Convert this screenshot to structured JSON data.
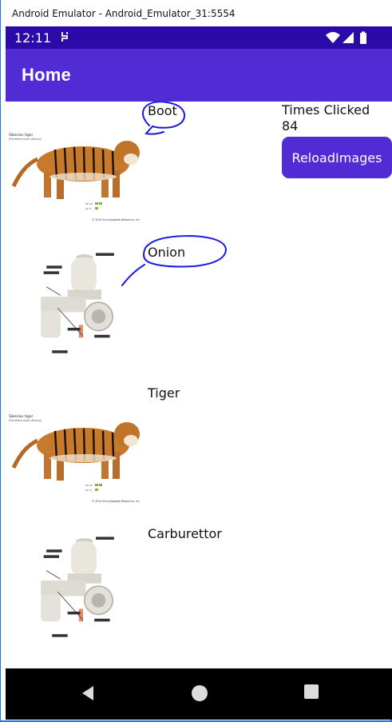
{
  "window": {
    "title": "Android Emulator - Android_Emulator_31:5554"
  },
  "status_bar": {
    "time": "12:11",
    "icons": [
      "sync-icon",
      "wifi-icon",
      "signal-icon",
      "battery-icon"
    ]
  },
  "app_bar": {
    "title": "Home"
  },
  "panel": {
    "times_clicked_label": "Times Clicked",
    "times_clicked_value": "84",
    "reload_button_label": "ReloadImages"
  },
  "rows": [
    {
      "label": "Boot",
      "image": "tiger"
    },
    {
      "label": "Onion",
      "image": "carburettor"
    },
    {
      "label": "Tiger",
      "image": "tiger"
    },
    {
      "label": "Carburettor",
      "image": "carburettor"
    }
  ],
  "figure_text": {
    "tiger_title": "Siberian tiger",
    "tiger_subtitle": "(Panthera tigris altaica)",
    "tiger_copyright": "© 2010 Encyclopædia Britannica, Inc."
  },
  "nav_bar": {
    "buttons": [
      "back",
      "home",
      "recent-apps"
    ]
  },
  "colors": {
    "status_bar": "#2a0ba8",
    "app_bar": "#512bd4",
    "button": "#512bd4",
    "scribble": "#1a1ae0",
    "nav_bar": "#000000",
    "frame_border": "#1e73e8"
  }
}
